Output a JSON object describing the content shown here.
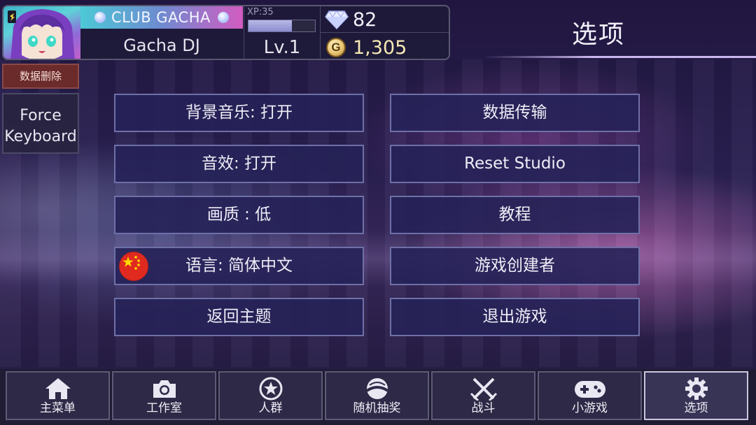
{
  "header": {
    "club_title": "CLUB GACHA",
    "player_name": "Gacha DJ",
    "xp_label": "XP:35",
    "xp_progress": 0.65,
    "level": "Lv.1",
    "gems": "82",
    "gold": "1,305",
    "gold_icon_letter": "G"
  },
  "page_title": "选项",
  "side": {
    "delete_data": "数据删除",
    "force_keyboard_line1": "Force",
    "force_keyboard_line2": "Keyboard"
  },
  "options": {
    "bgm": "背景音乐: 打开",
    "sfx": "音效: 打开",
    "quality": "画质 : 低",
    "language": "语言: 简体中文",
    "return_title": "返回主题",
    "data_transfer": "数据传输",
    "reset_studio": "Reset Studio",
    "tutorial": "教程",
    "game_creator": "游戏创建者",
    "exit_game": "退出游戏"
  },
  "nav": {
    "items": [
      {
        "label": "主菜单",
        "icon": "home-icon"
      },
      {
        "label": "工作室",
        "icon": "camera-icon"
      },
      {
        "label": "人群",
        "icon": "star-icon"
      },
      {
        "label": "随机抽奖",
        "icon": "gacha-orb-icon"
      },
      {
        "label": "战斗",
        "icon": "crossed-swords-icon"
      },
      {
        "label": "小游戏",
        "icon": "gamepad-icon"
      },
      {
        "label": "选项",
        "icon": "gear-icon"
      }
    ],
    "active_index": 6
  },
  "colors": {
    "button_border": "#6f70a8",
    "button_fill": "#262258",
    "delete_fill": "#6b2b2a",
    "club_gradient_start": "#4cc9d6",
    "club_gradient_end": "#d35cc1"
  }
}
